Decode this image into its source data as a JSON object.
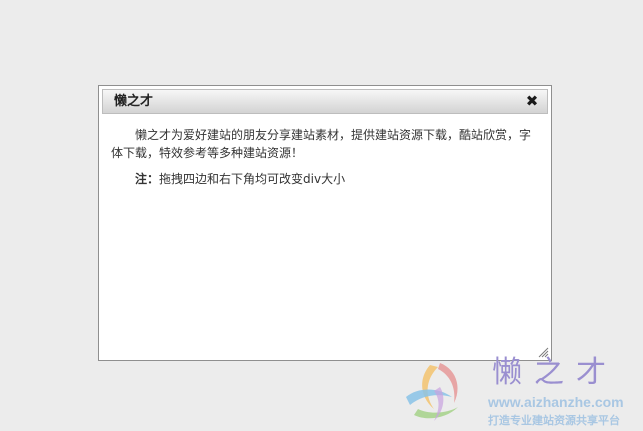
{
  "dialog": {
    "title": "懒之才",
    "close_glyph": "✖",
    "body_text": "懒之才为爱好建站的朋友分享建站素材，提供建站资源下载，酷站欣赏，字体下载，特效参考等多种建站资源！",
    "note_label": "注：",
    "note_text": "拖拽四边和右下角均可改变div大小"
  },
  "watermark": {
    "brand": "懒之才",
    "url": "www.aizhanzhe.com",
    "slogan": "打造专业建站资源共享平台"
  },
  "icons": {
    "close": "close-icon",
    "resize": "resize-grip-icon",
    "logo": "swirl-logo-icon"
  },
  "colors": {
    "page_background": "#ececec",
    "dialog_border": "#8f8f8f",
    "titlebar_gradient_top": "#f7f7f7",
    "titlebar_gradient_bottom": "#d3d3d3",
    "watermark_purple": "#9a8fd0",
    "watermark_blue": "#a9c7e3"
  }
}
